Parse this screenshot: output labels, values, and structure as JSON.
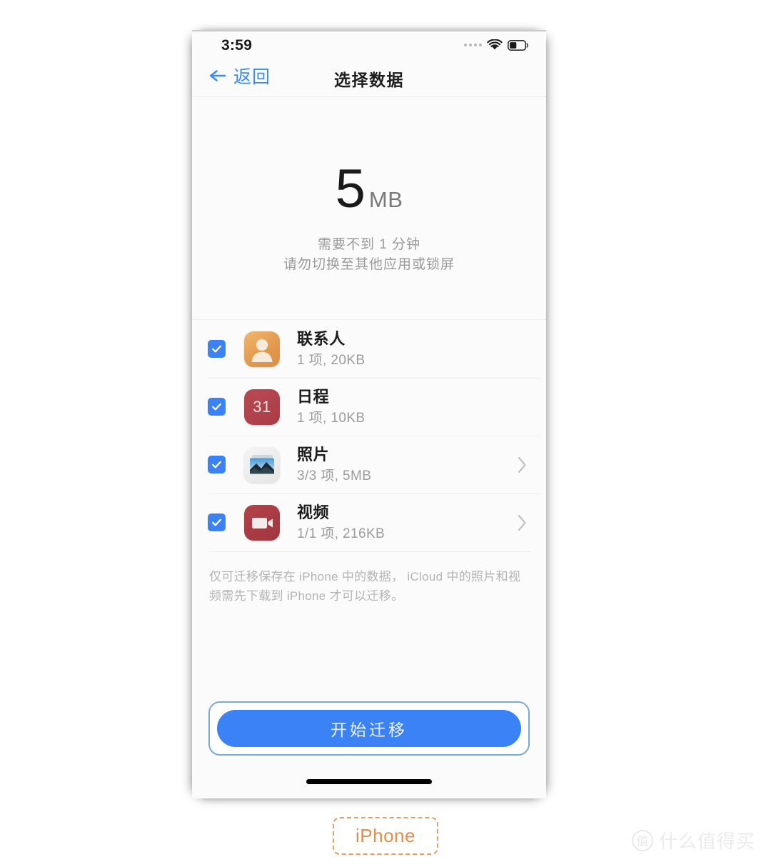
{
  "status_bar": {
    "time": "3:59",
    "signal_icon": "signal-dots-icon",
    "wifi_icon": "wifi-icon",
    "battery_icon": "battery-icon",
    "battery_level_percent": 42
  },
  "nav": {
    "back_label": "返回",
    "back_icon": "arrow-left-icon",
    "title": "选择数据"
  },
  "summary": {
    "size_number": "5",
    "size_unit": "MB",
    "note_1": "需要不到 1 分钟",
    "note_2": "请勿切换至其他应用或锁屏"
  },
  "list": {
    "rows": [
      {
        "title": "联系人",
        "subtitle": "1 项, 20KB",
        "icon": "contacts-icon",
        "checked": true,
        "has_chevron": false
      },
      {
        "title": "日程",
        "subtitle": "1 项, 10KB",
        "icon": "calendar-icon",
        "icon_text": "31",
        "checked": true,
        "has_chevron": false
      },
      {
        "title": "照片",
        "subtitle": "3/3 项, 5MB",
        "icon": "photos-icon",
        "checked": true,
        "has_chevron": true
      },
      {
        "title": "视频",
        "subtitle": "1/1 项, 216KB",
        "icon": "video-icon",
        "checked": true,
        "has_chevron": true
      }
    ]
  },
  "footnote": "仅可迁移保存在 iPhone 中的数据， iCloud 中的照片和视频需先下载到 iPhone 才可以迁移。",
  "action": {
    "start_label": "开始迁移"
  },
  "device_badge": {
    "label": "iPhone"
  },
  "watermark": {
    "mark": "值",
    "text": "什么值得买"
  },
  "colors": {
    "accent_blue": "#3b82f6",
    "link_blue": "#3a8bfd",
    "badge_orange": "#e08e4f",
    "screen_bg": "#fbfbfb"
  }
}
